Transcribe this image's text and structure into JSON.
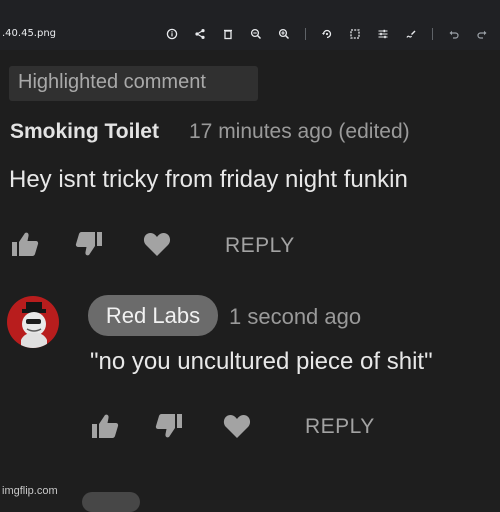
{
  "viewer": {
    "filename": ".40.45.png",
    "tools": [
      "info-icon",
      "share-icon",
      "delete-icon",
      "zoom-out-icon",
      "zoom-in-icon",
      "rotate-icon",
      "crop-icon",
      "adjust-icon",
      "markup-icon",
      "undo-icon",
      "redo-icon"
    ]
  },
  "highlighted_label": "Highlighted comment",
  "comment": {
    "author": "Smoking Toilet",
    "time": "17 minutes ago (edited)",
    "text": "Hey isnt tricky from friday night funkin",
    "reply_label": "REPLY"
  },
  "reply": {
    "author": "Red Labs",
    "time": "1 second ago",
    "text": "\"no you uncultured piece of shit\"",
    "reply_label": "REPLY"
  },
  "watermark": "imgflip.com",
  "colors": {
    "background": "#1e1e1e",
    "avatar_red": "#b81d1d",
    "author_pill": "#6b6b6b"
  }
}
